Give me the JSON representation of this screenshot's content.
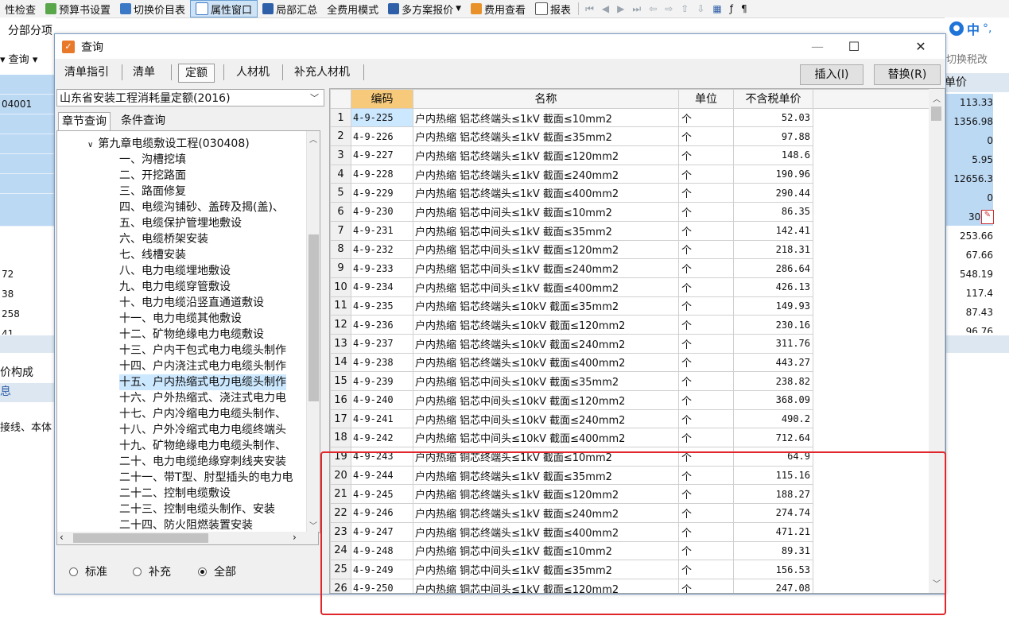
{
  "app": {
    "toolbar": [
      "性检查",
      "预算书设置",
      "切换价目表",
      "属性窗口",
      "局部汇总",
      "全费用模式",
      "多方案报价",
      "费用查看",
      "报表"
    ],
    "input_method": [
      "中",
      "°,"
    ],
    "colors": {
      "accent": "#cfe3f7",
      "row_blue": "#bcd9f4",
      "highlight": "#e0262a",
      "sorted_header": "#f7c97a"
    }
  },
  "background_left": {
    "tab": "分部分项",
    "query_label": "查询",
    "cells": [
      "04001",
      "72",
      "38",
      "258",
      "41"
    ],
    "bottom_tab": "价构成",
    "bottom_label": "息",
    "bottom_text": "接线、本体"
  },
  "background_right": {
    "switch_tax": "切换税改",
    "header": "单价",
    "values": [
      "113.33",
      "1356.98",
      "0",
      "5.95",
      "12656.3",
      "0",
      "30",
      "253.66",
      "67.66",
      "548.19",
      "117.4",
      "87.43",
      "96.76"
    ]
  },
  "dialog": {
    "title": "查询",
    "tabs": [
      "清单指引",
      "清单",
      "定额",
      "人材机",
      "补充人材机"
    ],
    "active_tab": "定额",
    "insert_button": "插入(I)",
    "replace_button": "替换(R)",
    "library": "山东省安装工程消耗量定额(2016)",
    "left_tabs": [
      "章节查询",
      "条件查询"
    ],
    "tree_root": "第九章电缆敷设工程(030408)",
    "tree_items": [
      "一、沟槽挖填",
      "二、开挖路面",
      "三、路面修复",
      "四、电缆沟铺砂、盖砖及揭(盖)、",
      "五、电缆保护管埋地敷设",
      "六、电缆桥架安装",
      "七、线槽安装",
      "八、电力电缆埋地敷设",
      "九、电力电缆穿管敷设",
      "十、电力电缆沿竖直通道敷设",
      "十一、电力电缆其他敷设",
      "十二、矿物绝缘电力电缆敷设",
      "十三、户内干包式电力电缆头制作",
      "十四、户内浇注式电力电缆头制作",
      "十五、户内热缩式电力电缆头制作",
      "十六、户外热缩式、浇注式电力电",
      "十七、户内冷缩电力电缆头制作、",
      "十八、户外冷缩式电力电缆终端头",
      "十九、矿物绝缘电力电缆头制作、",
      "二十、电力电缆绝缘穿刺线夹安装",
      "二十一、带T型、肘型插头的电力电",
      "二十二、控制电缆敷设",
      "二十三、控制电缆头制作、安装",
      "二十四、防火阻燃装置安装"
    ],
    "selected_tree_item": "十五、户内热缩式电力电缆头制作",
    "radios": [
      "标准",
      "补充",
      "全部"
    ],
    "radio_selected": "全部",
    "columns": [
      "编码",
      "名称",
      "单位",
      "不含税单价"
    ],
    "rows": [
      {
        "n": "1",
        "code": "4-9-225",
        "name": "户内热缩 铝芯终端头≤1kV 截面≤10mm2",
        "unit": "个",
        "price": "52.03"
      },
      {
        "n": "2",
        "code": "4-9-226",
        "name": "户内热缩 铝芯终端头≤1kV 截面≤35mm2",
        "unit": "个",
        "price": "97.88"
      },
      {
        "n": "3",
        "code": "4-9-227",
        "name": "户内热缩 铝芯终端头≤1kV 截面≤120mm2",
        "unit": "个",
        "price": "148.6"
      },
      {
        "n": "4",
        "code": "4-9-228",
        "name": "户内热缩 铝芯终端头≤1kV 截面≤240mm2",
        "unit": "个",
        "price": "190.96"
      },
      {
        "n": "5",
        "code": "4-9-229",
        "name": "户内热缩 铝芯终端头≤1kV 截面≤400mm2",
        "unit": "个",
        "price": "290.44"
      },
      {
        "n": "6",
        "code": "4-9-230",
        "name": "户内热缩 铝芯中间头≤1kV 截面≤10mm2",
        "unit": "个",
        "price": "86.35"
      },
      {
        "n": "7",
        "code": "4-9-231",
        "name": "户内热缩 铝芯中间头≤1kV 截面≤35mm2",
        "unit": "个",
        "price": "142.41"
      },
      {
        "n": "8",
        "code": "4-9-232",
        "name": "户内热缩 铝芯中间头≤1kV 截面≤120mm2",
        "unit": "个",
        "price": "218.31"
      },
      {
        "n": "9",
        "code": "4-9-233",
        "name": "户内热缩 铝芯中间头≤1kV 截面≤240mm2",
        "unit": "个",
        "price": "286.64"
      },
      {
        "n": "10",
        "code": "4-9-234",
        "name": "户内热缩 铝芯中间头≤1kV 截面≤400mm2",
        "unit": "个",
        "price": "426.13"
      },
      {
        "n": "11",
        "code": "4-9-235",
        "name": "户内热缩 铝芯终端头≤10kV 截面≤35mm2",
        "unit": "个",
        "price": "149.93"
      },
      {
        "n": "12",
        "code": "4-9-236",
        "name": "户内热缩 铝芯终端头≤10kV 截面≤120mm2",
        "unit": "个",
        "price": "230.16"
      },
      {
        "n": "13",
        "code": "4-9-237",
        "name": "户内热缩 铝芯终端头≤10kV 截面≤240mm2",
        "unit": "个",
        "price": "311.76"
      },
      {
        "n": "14",
        "code": "4-9-238",
        "name": "户内热缩 铝芯终端头≤10kV 截面≤400mm2",
        "unit": "个",
        "price": "443.27"
      },
      {
        "n": "15",
        "code": "4-9-239",
        "name": "户内热缩 铝芯中间头≤10kV 截面≤35mm2",
        "unit": "个",
        "price": "238.82"
      },
      {
        "n": "16",
        "code": "4-9-240",
        "name": "户内热缩 铝芯中间头≤10kV 截面≤120mm2",
        "unit": "个",
        "price": "368.09"
      },
      {
        "n": "17",
        "code": "4-9-241",
        "name": "户内热缩 铝芯中间头≤10kV 截面≤240mm2",
        "unit": "个",
        "price": "490.2"
      },
      {
        "n": "18",
        "code": "4-9-242",
        "name": "户内热缩 铝芯中间头≤10kV 截面≤400mm2",
        "unit": "个",
        "price": "712.64"
      },
      {
        "n": "19",
        "code": "4-9-243",
        "name": "户内热缩 铜芯终端头≤1kV 截面≤10mm2",
        "unit": "个",
        "price": "64.9"
      },
      {
        "n": "20",
        "code": "4-9-244",
        "name": "户内热缩 铜芯终端头≤1kV 截面≤35mm2",
        "unit": "个",
        "price": "115.16"
      },
      {
        "n": "21",
        "code": "4-9-245",
        "name": "户内热缩 铜芯终端头≤1kV 截面≤120mm2",
        "unit": "个",
        "price": "188.27"
      },
      {
        "n": "22",
        "code": "4-9-246",
        "name": "户内热缩 铜芯终端头≤1kV 截面≤240mm2",
        "unit": "个",
        "price": "274.74"
      },
      {
        "n": "23",
        "code": "4-9-247",
        "name": "户内热缩 铜芯终端头≤1kV 截面≤400mm2",
        "unit": "个",
        "price": "471.21"
      },
      {
        "n": "24",
        "code": "4-9-248",
        "name": "户内热缩 铜芯中间头≤1kV 截面≤10mm2",
        "unit": "个",
        "price": "89.31"
      },
      {
        "n": "25",
        "code": "4-9-249",
        "name": "户内热缩 铜芯中间头≤1kV 截面≤35mm2",
        "unit": "个",
        "price": "156.53"
      },
      {
        "n": "26",
        "code": "4-9-250",
        "name": "户内热缩 铜芯中间头≤1kV 截面≤120mm2",
        "unit": "个",
        "price": "247.08"
      }
    ]
  }
}
